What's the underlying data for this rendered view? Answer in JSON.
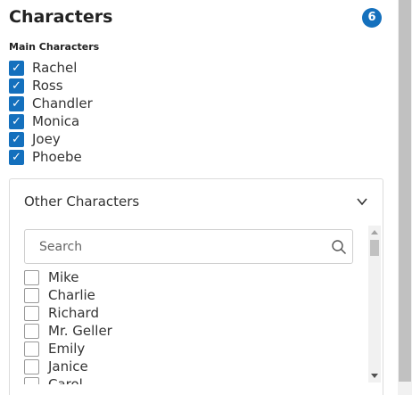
{
  "header": {
    "title": "Characters",
    "count": "6"
  },
  "main": {
    "label": "Main Characters",
    "items": [
      {
        "label": "Rachel",
        "checked": true
      },
      {
        "label": "Ross",
        "checked": true
      },
      {
        "label": "Chandler",
        "checked": true
      },
      {
        "label": "Monica",
        "checked": true
      },
      {
        "label": "Joey",
        "checked": true
      },
      {
        "label": "Phoebe",
        "checked": true
      }
    ]
  },
  "other": {
    "title": "Other Characters",
    "search": {
      "placeholder": "Search",
      "value": ""
    },
    "items": [
      {
        "label": "Mike",
        "checked": false
      },
      {
        "label": "Charlie",
        "checked": false
      },
      {
        "label": "Richard",
        "checked": false
      },
      {
        "label": "Mr. Geller",
        "checked": false
      },
      {
        "label": "Emily",
        "checked": false
      },
      {
        "label": "Janice",
        "checked": false
      },
      {
        "label": "Carol",
        "checked": false
      }
    ]
  },
  "colors": {
    "accent": "#1470bd",
    "border": "#dcdcdc"
  },
  "icons": {
    "check": "checkmark-icon",
    "chevron": "chevron-down-icon",
    "search": "search-icon"
  }
}
